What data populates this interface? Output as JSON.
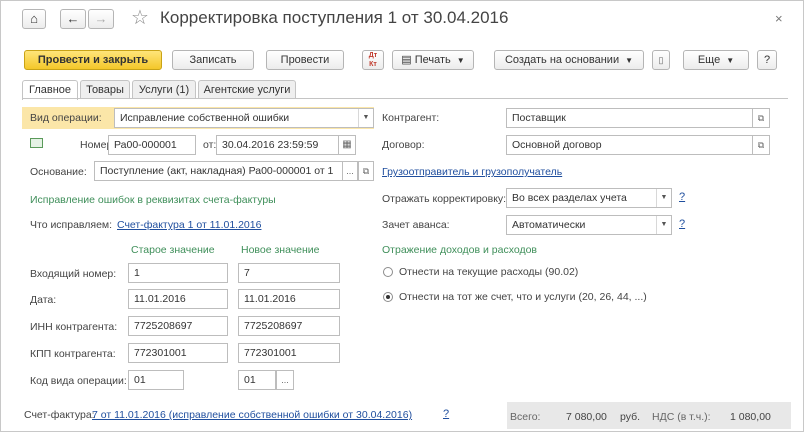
{
  "window": {
    "title": "Корректировка поступления 1 от 30.04.2016",
    "close": "×"
  },
  "nav": {
    "home": "⌂",
    "back": "←",
    "forward": "→",
    "favorite": "☆"
  },
  "toolbar": {
    "post_close": "Провести и закрыть",
    "save": "Записать",
    "post": "Провести",
    "print": "Печать",
    "create_based": "Создать на основании",
    "more": "Еще",
    "help": "?"
  },
  "tabs": [
    "Главное",
    "Товары",
    "Услуги (1)",
    "Агентские услуги"
  ],
  "form": {
    "operation_label": "Вид операции:",
    "operation_value": "Исправление собственной ошибки",
    "number_label": "Номер:",
    "number_value": "Ра00-000001",
    "date_from_label": "от:",
    "date_value": "30.04.2016 23:59:59",
    "basis_label": "Основание:",
    "basis_value": "Поступление (акт, накладная) Ра00-000001 от 1",
    "invoice_section": "Исправление ошибок в реквизитах счета-фактуры",
    "what_fix_label": "Что исправляем:",
    "what_fix_link": "Счет-фактура 1 от 11.01.2016",
    "old_header": "Старое значение",
    "new_header": "Новое значение",
    "rows": [
      {
        "label": "Входящий номер:",
        "old": "1",
        "new": "7"
      },
      {
        "label": "Дата:",
        "old": "11.01.2016",
        "new": "11.01.2016"
      },
      {
        "label": "ИНН контрагента:",
        "old": "7725208697",
        "new": "7725208697"
      },
      {
        "label": "КПП контрагента:",
        "old": "772301001",
        "new": "772301001"
      },
      {
        "label": "Код вида операции:",
        "old": "01",
        "new": "01"
      }
    ],
    "counterparty_label": "Контрагент:",
    "counterparty_value": "Поставщик",
    "contract_label": "Договор:",
    "contract_value": "Основной договор",
    "shipper_link": "Грузоотправитель и грузополучатель",
    "reflect_label": "Отражать корректировку:",
    "reflect_value": "Во всех разделах учета",
    "advance_label": "Зачет аванса:",
    "advance_value": "Автоматически",
    "income_section": "Отражение доходов и расходов",
    "radio1": "Отнести на текущие расходы (90.02)",
    "radio2": "Отнести на тот же счет, что и услуги (20, 26, 44, ...)"
  },
  "footer": {
    "invoice_label": "Счет-фактура:",
    "invoice_link": "7 от 11.01.2016 (исправление собственной ошибки от 30.04.2016)",
    "q": "?",
    "total_label": "Всего:",
    "total_value": "7 080,00",
    "currency": "руб.",
    "vat_label": "НДС (в т.ч.):",
    "vat_value": "1 080,00"
  },
  "icons": {
    "dropdown": "▼",
    "open": "⧉",
    "calendar": "▦",
    "ellipsis": "..."
  }
}
